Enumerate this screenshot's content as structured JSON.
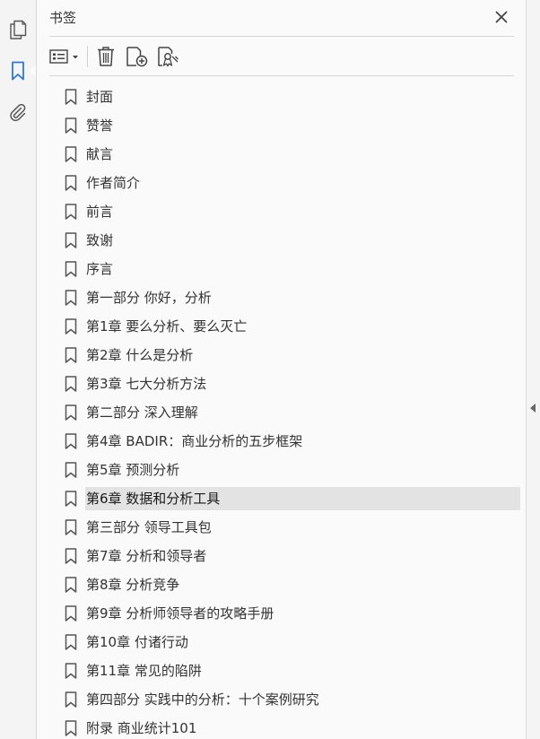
{
  "panel": {
    "title": "书签"
  },
  "icons": {
    "rail": [
      "pages-icon",
      "bookmark-icon",
      "paperclip-icon"
    ],
    "toolbar": [
      "options-icon",
      "trash-icon",
      "new-bookmark-icon",
      "bookmark-properties-icon"
    ],
    "close": "close-icon",
    "item": "bookmark-icon"
  },
  "colors": {
    "selected_row": "#e3e3e3",
    "active_rail_icon": "#2d77d6",
    "text": "#333333"
  },
  "bookmarks": [
    {
      "label": "封面"
    },
    {
      "label": "赞誉"
    },
    {
      "label": "献言"
    },
    {
      "label": "作者简介"
    },
    {
      "label": "前言"
    },
    {
      "label": "致谢"
    },
    {
      "label": "序言"
    },
    {
      "label": "第一部分 你好，分析"
    },
    {
      "label": "第1章 要么分析、要么灭亡"
    },
    {
      "label": "第2章 什么是分析"
    },
    {
      "label": "第3章 七大分析方法"
    },
    {
      "label": "第二部分 深入理解"
    },
    {
      "label": "第4章 BADIR：商业分析的五步框架"
    },
    {
      "label": "第5章 预测分析"
    },
    {
      "label": "第6章 数据和分析工具",
      "selected": true
    },
    {
      "label": "第三部分 领导工具包"
    },
    {
      "label": "第7章 分析和领导者"
    },
    {
      "label": "第8章 分析竞争"
    },
    {
      "label": "第9章 分析师领导者的攻略手册"
    },
    {
      "label": "第10章 付诸行动"
    },
    {
      "label": "第11章 常见的陷阱"
    },
    {
      "label": "第四部分 实践中的分析：十个案例研究"
    },
    {
      "label": "附录 商业统计101"
    }
  ]
}
